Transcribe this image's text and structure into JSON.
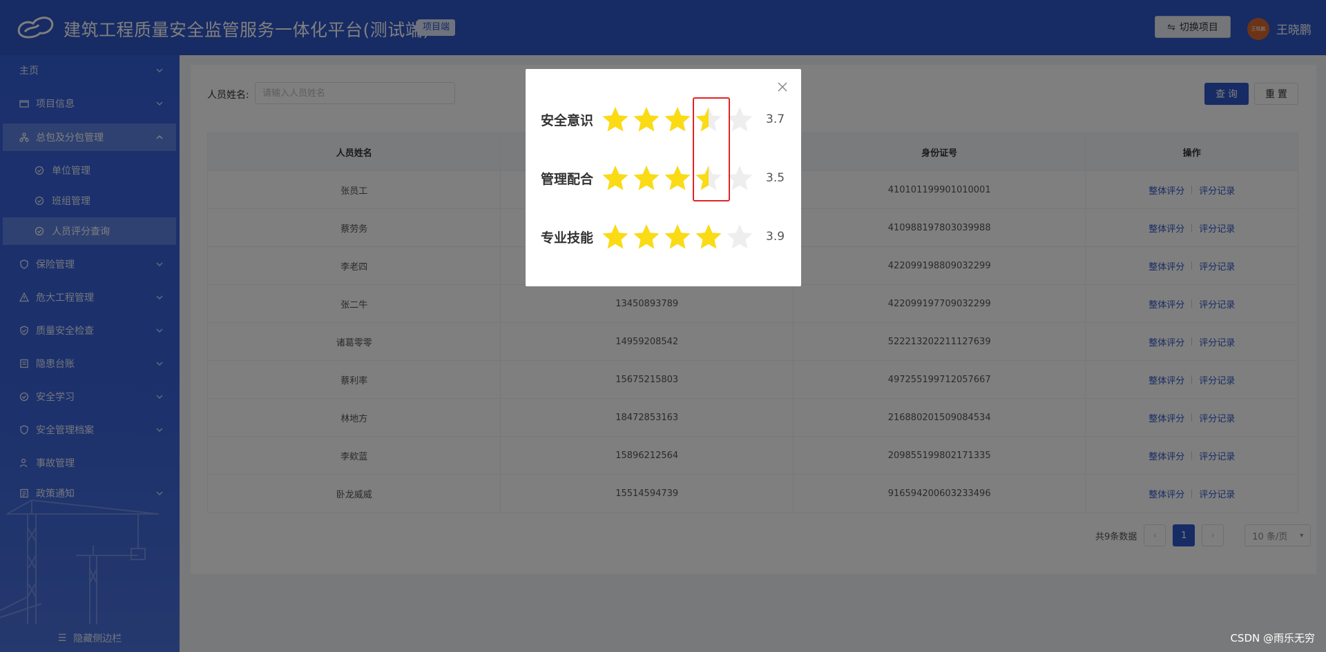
{
  "header": {
    "title": "建筑工程质量安全监管服务一体化平台(测试端)",
    "tag": "项目端",
    "switch_label": "切换项目",
    "avatar_text": "王晓鹏",
    "username": "王晓鹏"
  },
  "sidebar": {
    "items": [
      {
        "label": "主页",
        "icon": "home-icon"
      },
      {
        "label": "项目信息",
        "icon": "folder-icon"
      },
      {
        "label": "总包及分包管理",
        "icon": "org-icon"
      },
      {
        "label": "单位管理",
        "icon": "circle-check-icon"
      },
      {
        "label": "班组管理",
        "icon": "circle-check-icon"
      },
      {
        "label": "人员评分查询",
        "icon": "circle-check-icon"
      },
      {
        "label": "保险管理",
        "icon": "shield-icon"
      },
      {
        "label": "危大工程管理",
        "icon": "warning-icon"
      },
      {
        "label": "质量安全检查",
        "icon": "shield-check-icon"
      },
      {
        "label": "隐患台账",
        "icon": "ledger-icon"
      },
      {
        "label": "安全学习",
        "icon": "circle-check-icon"
      },
      {
        "label": "安全管理档案",
        "icon": "shield-icon"
      },
      {
        "label": "事故管理",
        "icon": "user-alert-icon"
      },
      {
        "label": "政策通知",
        "icon": "notice-icon"
      }
    ],
    "hide_label": "隐藏侧边栏"
  },
  "search": {
    "label": "人员姓名:",
    "placeholder": "请输入人员姓名",
    "query_label": "查 询",
    "reset_label": "重 置"
  },
  "table": {
    "headers": [
      "人员姓名",
      "",
      "身份证号",
      "操作"
    ],
    "action_rate": "整体评分",
    "action_record": "评分记录",
    "rows": [
      {
        "name": "张员工",
        "phone": "",
        "id": "410101199901010001"
      },
      {
        "name": "蔡劳务",
        "phone": "",
        "id": "410988197803039988"
      },
      {
        "name": "李老四",
        "phone": "",
        "id": "422099198809032299"
      },
      {
        "name": "张二牛",
        "phone": "13450893789",
        "id": "422099197709032299"
      },
      {
        "name": "诸葛零零",
        "phone": "14959208542",
        "id": "522213202211127639"
      },
      {
        "name": "蔡利率",
        "phone": "15675215803",
        "id": "497255199712057667"
      },
      {
        "name": "林地方",
        "phone": "18472853163",
        "id": "216880201509084534"
      },
      {
        "name": "李欸蓝",
        "phone": "15896212564",
        "id": "209855199802171335"
      },
      {
        "name": "卧龙威威",
        "phone": "15514594739",
        "id": "916594200603233496"
      }
    ]
  },
  "pagination": {
    "total_label": "共9条数据",
    "current_page": "1",
    "page_size_label": "10 条/页"
  },
  "modal": {
    "ratings": [
      {
        "label": "安全意识",
        "value": "3.7",
        "score": 3.7
      },
      {
        "label": "管理配合",
        "value": "3.5",
        "score": 3.5
      },
      {
        "label": "专业技能",
        "value": "3.9",
        "score": 3.9
      }
    ]
  },
  "colors": {
    "primary": "#2f56c9",
    "star": "#fadb14",
    "star_empty": "#eeeeee",
    "highlight_box": "#e32222"
  },
  "watermark": "CSDN @雨乐无穷"
}
